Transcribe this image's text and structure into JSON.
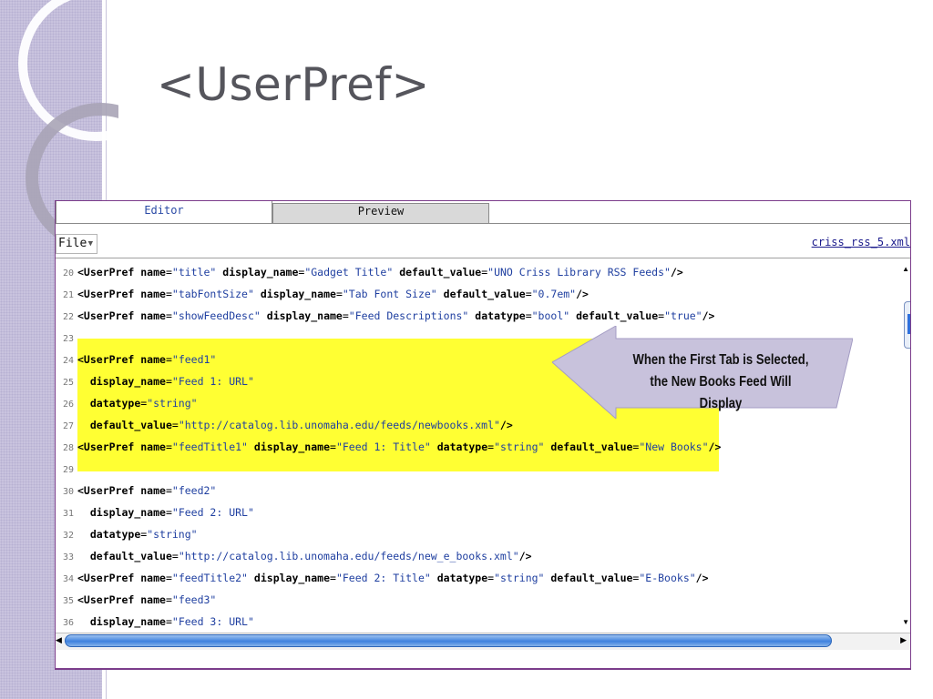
{
  "slide": {
    "title": "<UserPref>"
  },
  "app": {
    "tabs": [
      {
        "label": "Editor",
        "active": true
      },
      {
        "label": "Preview",
        "active": false
      }
    ],
    "toolbar": {
      "file_menu_label": "File",
      "file_name": "criss_rss_5.xml"
    }
  },
  "editor": {
    "lines": [
      {
        "num": "20",
        "tokens": [
          {
            "t": "tag",
            "v": "<UserPref "
          },
          {
            "t": "attr",
            "v": "name"
          },
          {
            "t": "text",
            "v": "="
          },
          {
            "t": "val",
            "v": "\"title\""
          },
          {
            "t": "text",
            "v": " "
          },
          {
            "t": "attr",
            "v": "display_name"
          },
          {
            "t": "text",
            "v": "="
          },
          {
            "t": "val",
            "v": "\"Gadget Title\""
          },
          {
            "t": "text",
            "v": " "
          },
          {
            "t": "attr",
            "v": "default_value"
          },
          {
            "t": "text",
            "v": "="
          },
          {
            "t": "val",
            "v": "\"UNO Criss Library RSS Feeds\""
          },
          {
            "t": "tag",
            "v": "/>"
          }
        ]
      },
      {
        "num": "21",
        "tokens": [
          {
            "t": "tag",
            "v": "<UserPref "
          },
          {
            "t": "attr",
            "v": "name"
          },
          {
            "t": "text",
            "v": "="
          },
          {
            "t": "val",
            "v": "\"tabFontSize\""
          },
          {
            "t": "text",
            "v": " "
          },
          {
            "t": "attr",
            "v": "display_name"
          },
          {
            "t": "text",
            "v": "="
          },
          {
            "t": "val",
            "v": "\"Tab Font Size\""
          },
          {
            "t": "text",
            "v": " "
          },
          {
            "t": "attr",
            "v": "default_value"
          },
          {
            "t": "text",
            "v": "="
          },
          {
            "t": "val",
            "v": "\"0.7em\""
          },
          {
            "t": "tag",
            "v": "/>"
          }
        ]
      },
      {
        "num": "22",
        "tokens": [
          {
            "t": "tag",
            "v": "<UserPref "
          },
          {
            "t": "attr",
            "v": "name"
          },
          {
            "t": "text",
            "v": "="
          },
          {
            "t": "val",
            "v": "\"showFeedDesc\""
          },
          {
            "t": "text",
            "v": " "
          },
          {
            "t": "attr",
            "v": "display_name"
          },
          {
            "t": "text",
            "v": "="
          },
          {
            "t": "val",
            "v": "\"Feed Descriptions\""
          },
          {
            "t": "text",
            "v": " "
          },
          {
            "t": "attr",
            "v": "datatype"
          },
          {
            "t": "text",
            "v": "="
          },
          {
            "t": "val",
            "v": "\"bool\""
          },
          {
            "t": "text",
            "v": " "
          },
          {
            "t": "attr",
            "v": "default_value"
          },
          {
            "t": "text",
            "v": "="
          },
          {
            "t": "val",
            "v": "\"true\""
          },
          {
            "t": "tag",
            "v": "/>"
          }
        ]
      },
      {
        "num": "23",
        "tokens": []
      },
      {
        "num": "24",
        "tokens": [
          {
            "t": "tag",
            "v": "<UserPref "
          },
          {
            "t": "attr",
            "v": "name"
          },
          {
            "t": "text",
            "v": "="
          },
          {
            "t": "val",
            "v": "\"feed1\""
          }
        ]
      },
      {
        "num": "25",
        "tokens": [
          {
            "t": "text",
            "v": "  "
          },
          {
            "t": "attr",
            "v": "display_name"
          },
          {
            "t": "text",
            "v": "="
          },
          {
            "t": "val",
            "v": "\"Feed 1: URL\""
          }
        ]
      },
      {
        "num": "26",
        "tokens": [
          {
            "t": "text",
            "v": "  "
          },
          {
            "t": "attr",
            "v": "datatype"
          },
          {
            "t": "text",
            "v": "="
          },
          {
            "t": "val",
            "v": "\"string\""
          }
        ]
      },
      {
        "num": "27",
        "tokens": [
          {
            "t": "text",
            "v": "  "
          },
          {
            "t": "attr",
            "v": "default_value"
          },
          {
            "t": "text",
            "v": "="
          },
          {
            "t": "val",
            "v": "\"http://catalog.lib.unomaha.edu/feeds/newbooks.xml\""
          },
          {
            "t": "tag",
            "v": "/>"
          }
        ]
      },
      {
        "num": "28",
        "tokens": [
          {
            "t": "tag",
            "v": "<UserPref "
          },
          {
            "t": "attr",
            "v": "name"
          },
          {
            "t": "text",
            "v": "="
          },
          {
            "t": "val",
            "v": "\"feedTitle1\""
          },
          {
            "t": "text",
            "v": " "
          },
          {
            "t": "attr",
            "v": "display_name"
          },
          {
            "t": "text",
            "v": "="
          },
          {
            "t": "val",
            "v": "\"Feed 1: Title\""
          },
          {
            "t": "text",
            "v": " "
          },
          {
            "t": "attr",
            "v": "datatype"
          },
          {
            "t": "text",
            "v": "="
          },
          {
            "t": "val",
            "v": "\"string\""
          },
          {
            "t": "text",
            "v": " "
          },
          {
            "t": "attr",
            "v": "default_value"
          },
          {
            "t": "text",
            "v": "="
          },
          {
            "t": "val",
            "v": "\"New Books\""
          },
          {
            "t": "tag",
            "v": "/>"
          }
        ]
      },
      {
        "num": "29",
        "tokens": []
      },
      {
        "num": "30",
        "tokens": [
          {
            "t": "tag",
            "v": "<UserPref "
          },
          {
            "t": "attr",
            "v": "name"
          },
          {
            "t": "text",
            "v": "="
          },
          {
            "t": "val",
            "v": "\"feed2\""
          }
        ]
      },
      {
        "num": "31",
        "tokens": [
          {
            "t": "text",
            "v": "  "
          },
          {
            "t": "attr",
            "v": "display_name"
          },
          {
            "t": "text",
            "v": "="
          },
          {
            "t": "val",
            "v": "\"Feed 2: URL\""
          }
        ]
      },
      {
        "num": "32",
        "tokens": [
          {
            "t": "text",
            "v": "  "
          },
          {
            "t": "attr",
            "v": "datatype"
          },
          {
            "t": "text",
            "v": "="
          },
          {
            "t": "val",
            "v": "\"string\""
          }
        ]
      },
      {
        "num": "33",
        "tokens": [
          {
            "t": "text",
            "v": "  "
          },
          {
            "t": "attr",
            "v": "default_value"
          },
          {
            "t": "text",
            "v": "="
          },
          {
            "t": "val",
            "v": "\"http://catalog.lib.unomaha.edu/feeds/new_e_books.xml\""
          },
          {
            "t": "tag",
            "v": "/>"
          }
        ]
      },
      {
        "num": "34",
        "tokens": [
          {
            "t": "tag",
            "v": "<UserPref "
          },
          {
            "t": "attr",
            "v": "name"
          },
          {
            "t": "text",
            "v": "="
          },
          {
            "t": "val",
            "v": "\"feedTitle2\""
          },
          {
            "t": "text",
            "v": " "
          },
          {
            "t": "attr",
            "v": "display_name"
          },
          {
            "t": "text",
            "v": "="
          },
          {
            "t": "val",
            "v": "\"Feed 2: Title\""
          },
          {
            "t": "text",
            "v": " "
          },
          {
            "t": "attr",
            "v": "datatype"
          },
          {
            "t": "text",
            "v": "="
          },
          {
            "t": "val",
            "v": "\"string\""
          },
          {
            "t": "text",
            "v": " "
          },
          {
            "t": "attr",
            "v": "default_value"
          },
          {
            "t": "text",
            "v": "="
          },
          {
            "t": "val",
            "v": "\"E-Books\""
          },
          {
            "t": "tag",
            "v": "/>"
          }
        ]
      },
      {
        "num": "35",
        "tokens": [
          {
            "t": "tag",
            "v": "<UserPref "
          },
          {
            "t": "attr",
            "v": "name"
          },
          {
            "t": "text",
            "v": "="
          },
          {
            "t": "val",
            "v": "\"feed3\""
          }
        ]
      },
      {
        "num": "36",
        "tokens": [
          {
            "t": "text",
            "v": "  "
          },
          {
            "t": "attr",
            "v": "display_name"
          },
          {
            "t": "text",
            "v": "="
          },
          {
            "t": "val",
            "v": "\"Feed 3: URL\""
          }
        ]
      }
    ]
  },
  "callout": {
    "line1": "When the First Tab is Selected,",
    "line2": "the New Books Feed Will Display"
  },
  "colors": {
    "highlight": "#ffff33",
    "callout_fill": "#c8c2dc",
    "frame_border": "#7b3d8b",
    "value_text": "#1f3fa0"
  }
}
